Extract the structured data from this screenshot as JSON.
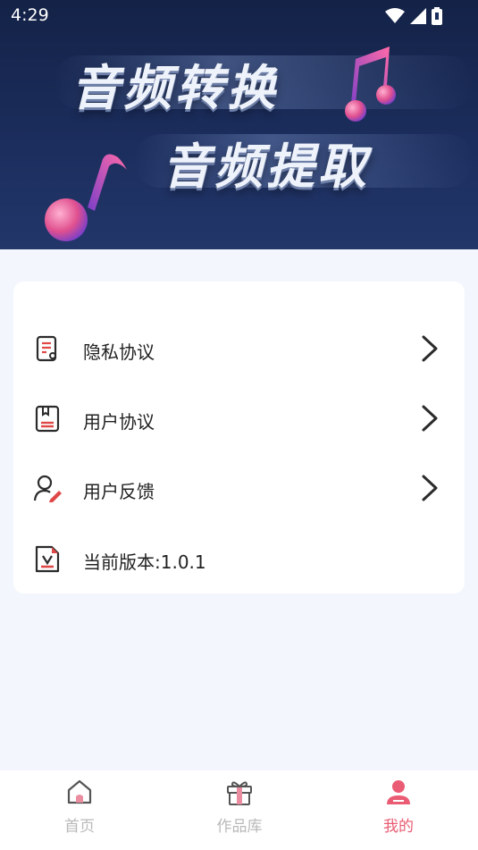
{
  "status_bar": {
    "time": "4:29"
  },
  "banner": {
    "title_line1": "音频转换",
    "title_line2": "音频提取"
  },
  "menu": {
    "items": [
      {
        "label": "隐私协议",
        "icon": "privacy-doc-icon",
        "has_chevron": true
      },
      {
        "label": "用户协议",
        "icon": "user-agreement-icon",
        "has_chevron": true
      },
      {
        "label": "用户反馈",
        "icon": "feedback-icon",
        "has_chevron": true
      },
      {
        "label": "当前版本:1.0.1",
        "icon": "version-icon",
        "has_chevron": false
      }
    ]
  },
  "tabbar": {
    "tabs": [
      {
        "label": "首页",
        "icon": "home-icon",
        "active": false
      },
      {
        "label": "作品库",
        "icon": "gift-icon",
        "active": false
      },
      {
        "label": "我的",
        "icon": "profile-icon",
        "active": true
      }
    ]
  },
  "colors": {
    "accent": "#ea5c73",
    "banner_bg": "#1b2d5c",
    "page_bg": "#f3f6fc",
    "inactive": "#b9b9b9"
  }
}
